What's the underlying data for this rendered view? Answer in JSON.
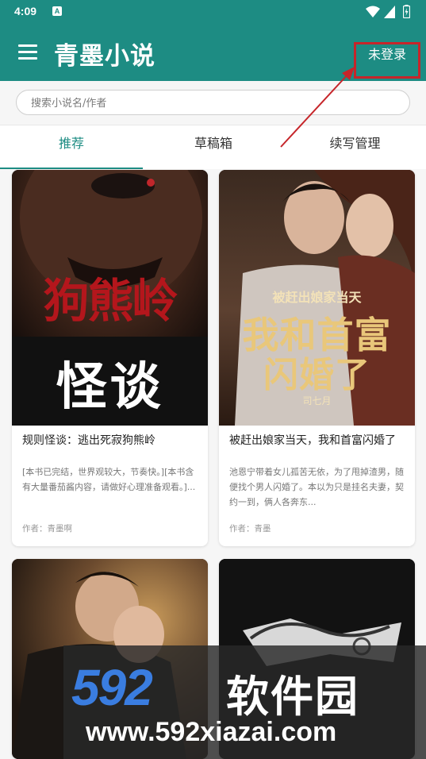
{
  "status_bar": {
    "time": "4:09",
    "notification_glyph": "A",
    "icons": [
      "wifi-icon",
      "signal-icon",
      "battery-icon"
    ]
  },
  "app_bar": {
    "title": "青墨小说",
    "login_label": "未登录",
    "menu_icon": "hamburger-menu-icon"
  },
  "search": {
    "placeholder": "搜索小说名/作者",
    "value": ""
  },
  "tabs": [
    {
      "label": "推荐",
      "active": true
    },
    {
      "label": "草稿箱",
      "active": false
    },
    {
      "label": "续写管理",
      "active": false
    }
  ],
  "books": [
    {
      "cover_text_main": "狗熊岭",
      "cover_text_sub": "怪谈",
      "title": "规则怪谈：逃出死寂狗熊岭",
      "description": "[本书已完结，世界观较大，节奏快。][本书含有大量番茄酱内容，请做好心理准备观看。]...",
      "author": "作者：青墨啊"
    },
    {
      "cover_text_top": "被赶出娘家当天",
      "cover_text_main": "我和首富",
      "cover_text_sub": "闪婚了",
      "cover_author": "司七月",
      "title": "被赶出娘家当天，我和首富闪婚了",
      "description": "池恩宁带着女儿孤苦无依，为了甩掉渣男，随便找个男人闪婚了。本以为只是挂名夫妻，契约一到，俩人各奔东...",
      "author": "作者：青墨"
    }
  ],
  "watermark": {
    "logo": "592",
    "name": "软件园",
    "url": "www.592xiazai.com"
  },
  "colors": {
    "primary": "#1d8c83",
    "highlight_box": "#c6252a",
    "background": "#f6f6f6"
  }
}
